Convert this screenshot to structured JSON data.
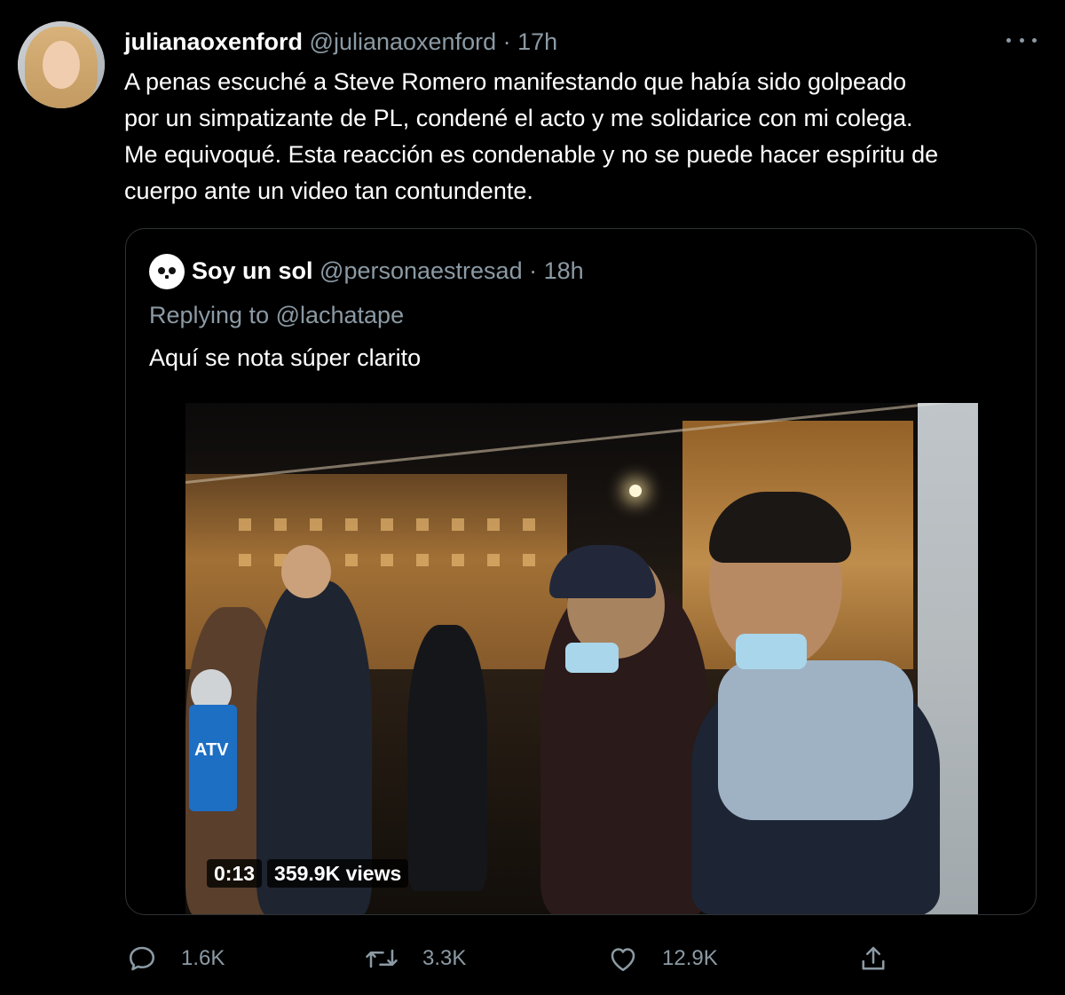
{
  "tweet": {
    "display_name": "julianaoxenford",
    "handle": "@julianaoxenford",
    "separator": "·",
    "time": "17h",
    "text_lines": [
      "A penas escuché a Steve Romero manifestando que había sido golpeado",
      "por un simpatizante de PL, condené el acto y me solidarice con mi colega.",
      "Me equivoqué. Esta reacción es condenable y no se puede hacer espíritu de",
      "cuerpo ante un video tan contundente."
    ],
    "more_icon": "more-horizontal-icon"
  },
  "quoted_tweet": {
    "display_name": "Soy un sol",
    "handle": "@personaestresad",
    "separator": "·",
    "time": "18h",
    "replying_to": "Replying to @lachatape",
    "text": "Aquí se nota súper clarito",
    "video": {
      "duration": "0:13",
      "views": "359.9K views",
      "mic_logo": "ATV"
    }
  },
  "actions": {
    "reply": {
      "icon": "reply-icon",
      "count": "1.6K"
    },
    "retweet": {
      "icon": "retweet-icon",
      "count": "3.3K"
    },
    "like": {
      "icon": "heart-icon",
      "count": "12.9K"
    },
    "share": {
      "icon": "share-icon"
    }
  },
  "colors": {
    "background": "#000000",
    "primary_text": "#ffffff",
    "secondary_text": "#8b9aa4",
    "border": "#2f3336"
  }
}
